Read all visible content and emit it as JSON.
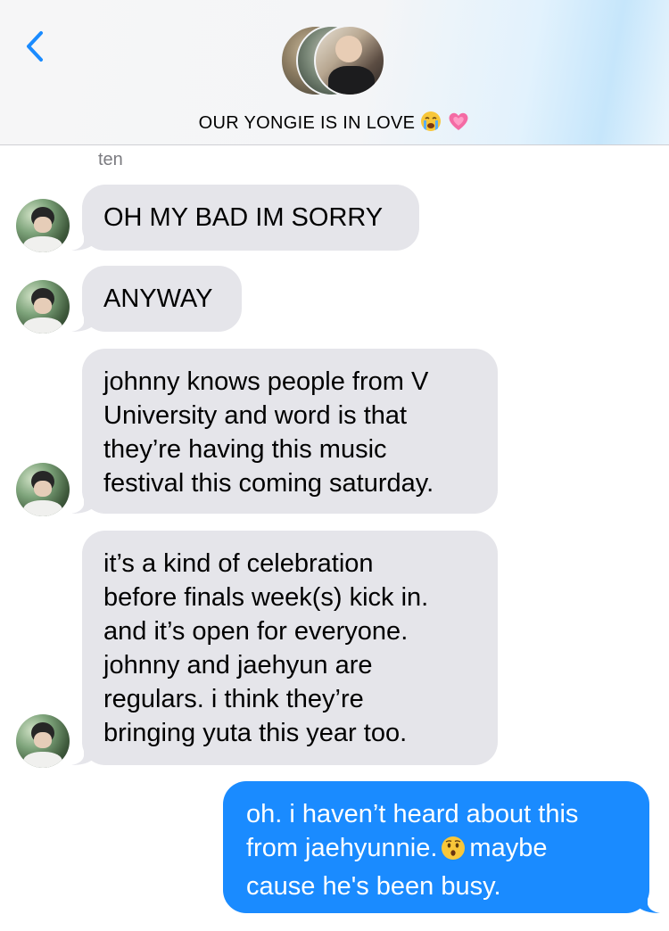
{
  "header": {
    "back_icon": "chevron-left-icon",
    "group_title": "OUR YONGIE IS IN LOVE",
    "title_emojis": [
      "crying-face-emoji",
      "growing-heart-emoji"
    ]
  },
  "thread": {
    "sender_name": "ten",
    "incoming": [
      {
        "text": "OH MY BAD IM SORRY"
      },
      {
        "text": "ANYWAY"
      },
      {
        "text": "johnny knows people from V\nUniversity and word is that\nthey’re having this music\nfestival this coming saturday."
      },
      {
        "text": "it’s a kind of celebration\nbefore finals week(s) kick in.\nand it’s open for everyone.\njohnny and jaehyun are\nregulars. i think they’re\nbringing yuta this year too."
      }
    ],
    "outgoing": {
      "line1": "oh. i haven’t heard about this",
      "line2_before": "from jaehyunnie.",
      "line2_emoji": "hushed-face-emoji",
      "line2_after": "maybe",
      "line3": "cause he's been busy."
    }
  },
  "colors": {
    "incoming_bubble": "#e5e5ea",
    "outgoing_bubble": "#1a8bff",
    "accent": "#1a8bff",
    "sender_name": "#7b7b80"
  }
}
